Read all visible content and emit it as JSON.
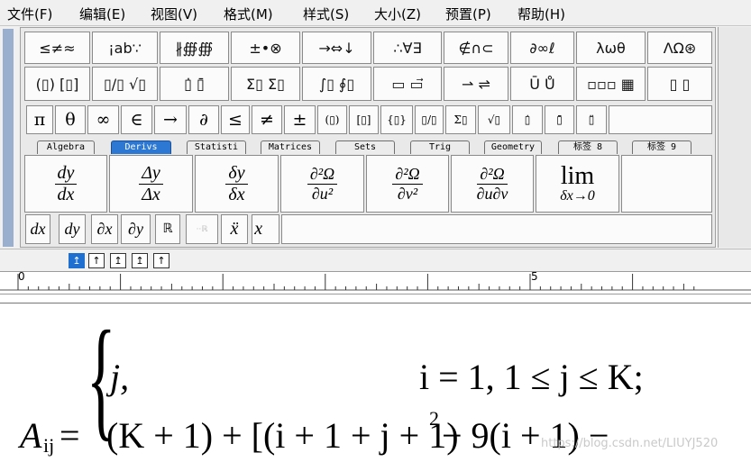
{
  "menu": {
    "items": [
      {
        "label": "文件(F)"
      },
      {
        "label": "编辑(E)"
      },
      {
        "label": "视图(V)"
      },
      {
        "label": "格式(M)"
      },
      {
        "label": "样式(S)"
      },
      {
        "label": "大小(Z)"
      },
      {
        "label": "预置(P)"
      },
      {
        "label": "帮助(H)"
      }
    ]
  },
  "palette": {
    "row1": [
      "≤≠≈",
      "¡ab∵",
      "∦∰∰",
      "±•⊗",
      "→⇔↓",
      "∴∀∃",
      "∉∩⊂",
      "∂∞ℓ",
      "λωθ",
      "ΛΩ⊛"
    ],
    "row2": [
      "(▯) [▯]",
      "▯/▯ √▯",
      "▯̇ ▯̄",
      "Σ▯ Σ▯",
      "∫▯ ∮▯",
      "▭ ▭⃗",
      "⇀ ⇌",
      "Ū Ů",
      "▫▫▫ ▦",
      "▯ ▯"
    ],
    "symbols": [
      "π",
      "θ",
      "∞",
      "∈",
      "→",
      "∂",
      "≤",
      "≠",
      "±",
      "(▯)",
      "[▯]",
      "{▯}",
      "▯/▯",
      "Σ▯",
      "√▯",
      "▯̇",
      "▯̄",
      "▯̈"
    ],
    "tabs": [
      "Algebra",
      "Derivs",
      "Statisti",
      "Matrices",
      "Sets",
      "Trig",
      "Geometry",
      "标签 8",
      "标签 9"
    ],
    "active_tab": "Derivs",
    "templates": [
      {
        "num": "dy",
        "den": "dx"
      },
      {
        "num": "Δy",
        "den": "Δx"
      },
      {
        "num": "δy",
        "den": "δx"
      },
      {
        "num": "∂²Ω",
        "den": "∂u²"
      },
      {
        "num": "∂²Ω",
        "den": "∂v²"
      },
      {
        "num": "∂²Ω",
        "den": "∂u∂v"
      },
      {
        "num": "lim",
        "den": "δx→0"
      }
    ],
    "small_templates": [
      "dx",
      "dy",
      "∂x",
      "∂y",
      "ℝ",
      "··ℝ",
      "ẍ",
      "x⃛"
    ]
  },
  "align_buttons": [
    "↥",
    "↑",
    "↥",
    "↥",
    "↑"
  ],
  "ruler": {
    "labels": [
      "0",
      "5"
    ]
  },
  "equation": {
    "lhs": "A",
    "lhs_sub": "ij",
    "equals": "=",
    "brace": "{",
    "case1_expr": "j,",
    "case1_cond": "i = 1,     1 ≤ j ≤ K;",
    "case2_expr": "(K + 1) + [(i + 1 + j + 1)",
    "case2_sup": "2",
    "case2_tail": " − 9(i + 1) −"
  },
  "watermark": "https://blog.csdn.net/LIUYJ520"
}
